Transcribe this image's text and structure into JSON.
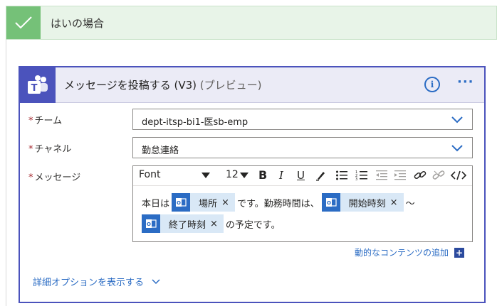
{
  "condition": {
    "title": "はいの場合"
  },
  "action": {
    "title": "メッセージを投稿する (V3)",
    "preview": "(プレビュー)",
    "more": "···"
  },
  "fields": {
    "team": {
      "label": "チーム",
      "value": "dept-itsp-bi1-医sb-emp"
    },
    "channel": {
      "label": "チャネル",
      "value": "勤怠連絡"
    },
    "message": {
      "label": "メッセージ"
    }
  },
  "toolbar": {
    "font": "Font",
    "size": "12"
  },
  "editor": {
    "t1": "本日は",
    "token1": "場所",
    "t2": "です。勤務時間は、",
    "token2": "開始時刻",
    "t3": "〜",
    "token3": "終了時刻",
    "t4": "の予定です。",
    "remove": "×"
  },
  "links": {
    "dynamic": "動的なコンテンツの追加",
    "advanced": "詳細オプションを表示する"
  },
  "colors": {
    "accent": "#4b53bc",
    "link": "#2b6cc4",
    "success": "#75c178"
  }
}
